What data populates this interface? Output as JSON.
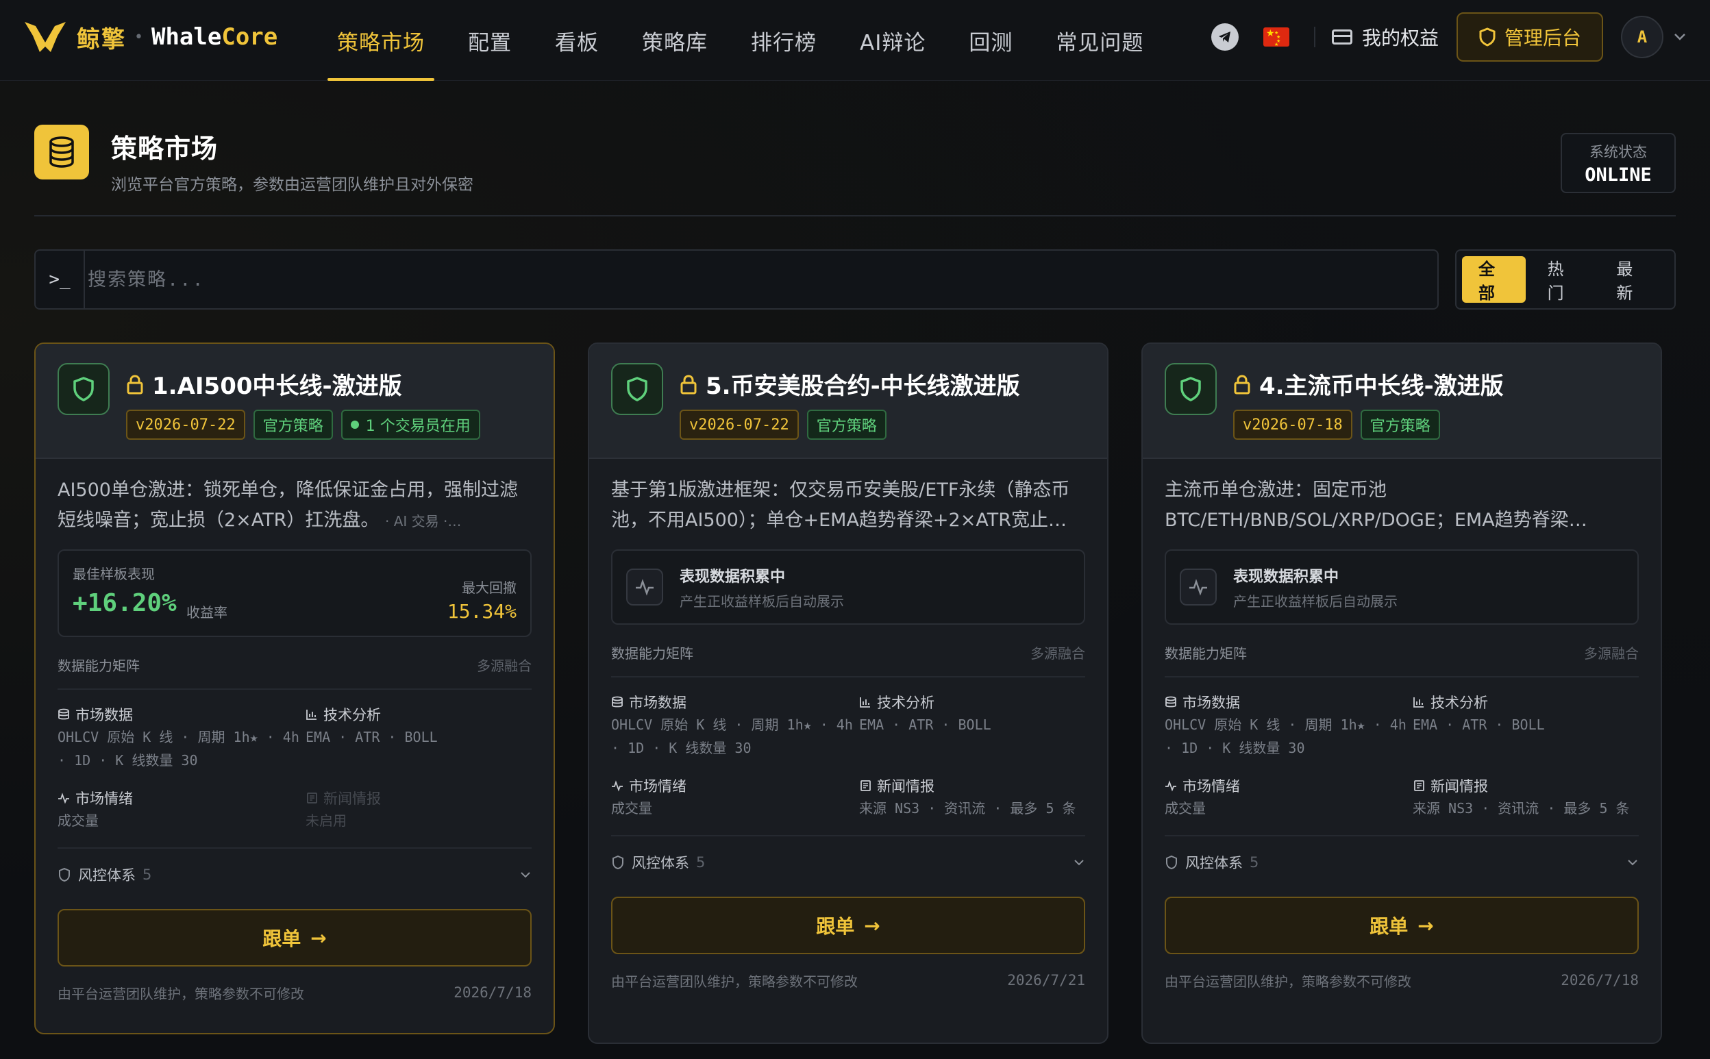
{
  "nav": {
    "logo_cn": "鲸擎",
    "logo_sep": "•",
    "logo_en_a": "Whale",
    "logo_en_b": "Core",
    "items": [
      "策略市场",
      "配置",
      "看板",
      "策略库",
      "排行榜",
      "AI辩论",
      "回测",
      "常见问题"
    ],
    "active_index": 0,
    "benefits": "我的权益",
    "admin": "管理后台",
    "avatar": "A"
  },
  "header": {
    "title": "策略市场",
    "subtitle": "浏览平台官方策略，参数由运营团队维护且对外保密",
    "status_label": "系统状态",
    "status_value": "ONLINE"
  },
  "search": {
    "prompt": ">_",
    "placeholder": "搜索策略..."
  },
  "filters": [
    "全部",
    "热门",
    "最新"
  ],
  "cards": [
    {
      "title": "1.AI500中长线-激进版",
      "version": "v2026-07-22",
      "official": "官方策略",
      "in_use": "1 个交易员在用",
      "desc": "AI500单仓激进：锁死单仓，降低保证金占用，强制过滤短线噪音；宽止损（2×ATR）扛洗盘。",
      "desc_tags": "· AI 交易 ·…",
      "perf_label": "最佳样板表现",
      "perf_value": "+16.20%",
      "perf_unit": "收益率",
      "dd_label": "最大回撤",
      "dd_value": "15.34%",
      "matrix_title": "数据能力矩阵",
      "matrix_src": "多源融合",
      "market_title": "市场数据",
      "market_text": "OHLCV 原始 K 线 · 周期 1h★ · 4h · 1D · K 线数量 30",
      "tech_title": "技术分析",
      "tech_text": "EMA · ATR · BOLL",
      "senti_title": "市场情绪",
      "senti_text": "成交量",
      "news_title": "新闻情报",
      "news_text": "未启用",
      "risk_label": "风控体系",
      "risk_count": "5",
      "follow": "跟单",
      "foot_note": "由平台运营团队维护，策略参数不可修改",
      "foot_date": "2026/7/18"
    },
    {
      "title": "5.币安美股合约-中长线激进版",
      "version": "v2026-07-22",
      "official": "官方策略",
      "desc": "基于第1版激进框架：仅交易币安美股/ETF永续（静态币池，不用AI500）；单仓+EMA趋势脊梁+2×ATR宽止…",
      "empty_title": "表现数据积累中",
      "empty_sub": "产生正收益样板后自动展示",
      "matrix_title": "数据能力矩阵",
      "matrix_src": "多源融合",
      "market_title": "市场数据",
      "market_text": "OHLCV 原始 K 线 · 周期 1h★ · 4h · 1D · K 线数量 30",
      "tech_title": "技术分析",
      "tech_text": "EMA · ATR · BOLL",
      "senti_title": "市场情绪",
      "senti_text": "成交量",
      "news_title": "新闻情报",
      "news_text": "来源 NS3 · 资讯流 · 最多 5 条",
      "risk_label": "风控体系",
      "risk_count": "5",
      "follow": "跟单",
      "foot_note": "由平台运营团队维护，策略参数不可修改",
      "foot_date": "2026/7/21"
    },
    {
      "title": "4.主流币中长线-激进版",
      "version": "v2026-07-18",
      "official": "官方策略",
      "desc": "主流币单仓激进：固定币池BTC/ETH/BNB/SOL/XRP/DOGE；EMA趋势脊梁…",
      "empty_title": "表现数据积累中",
      "empty_sub": "产生正收益样板后自动展示",
      "matrix_title": "数据能力矩阵",
      "matrix_src": "多源融合",
      "market_title": "市场数据",
      "market_text": "OHLCV 原始 K 线 · 周期 1h★ · 4h · 1D · K 线数量 30",
      "tech_title": "技术分析",
      "tech_text": "EMA · ATR · BOLL",
      "senti_title": "市场情绪",
      "senti_text": "成交量",
      "news_title": "新闻情报",
      "news_text": "来源 NS3 · 资讯流 · 最多 5 条",
      "risk_label": "风控体系",
      "risk_count": "5",
      "follow": "跟单",
      "foot_note": "由平台运营团队维护，策略参数不可修改",
      "foot_date": "2026/7/18"
    }
  ],
  "colors": {
    "accent": "#f0c43a",
    "positive": "#5fd07c",
    "background": "#0d0f12"
  },
  "icons": [
    "whale-logo-icon",
    "telegram-icon",
    "china-flag-icon",
    "card-icon",
    "shield-icon",
    "chevron-down-icon",
    "database-icon",
    "terminal-prompt-icon",
    "lock-icon",
    "pulse-icon",
    "bar-chart-icon",
    "newspaper-icon",
    "arrow-right-icon"
  ]
}
